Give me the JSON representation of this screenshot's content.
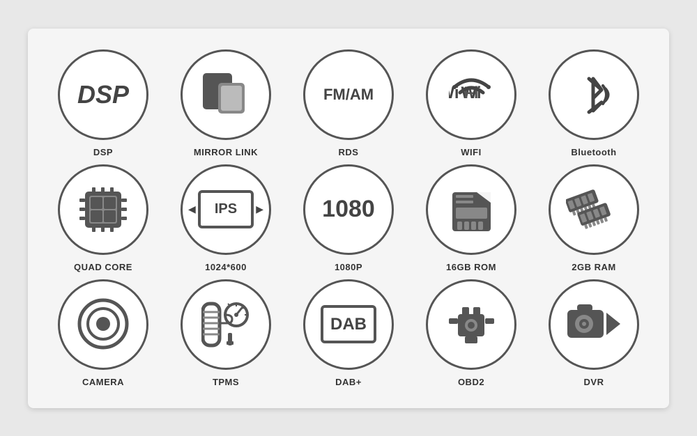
{
  "features": {
    "row1": [
      {
        "id": "dsp",
        "label": "DSP"
      },
      {
        "id": "mirror-link",
        "label": "MIRROR LINK"
      },
      {
        "id": "rds",
        "label": "RDS"
      },
      {
        "id": "wifi",
        "label": "WIFI"
      },
      {
        "id": "bluetooth",
        "label": "Bluetooth"
      }
    ],
    "row2": [
      {
        "id": "quad-core",
        "label": "QUAD CORE"
      },
      {
        "id": "ips",
        "label": "1024*600"
      },
      {
        "id": "1080p",
        "label": "1080P"
      },
      {
        "id": "16gb-rom",
        "label": "16GB ROM"
      },
      {
        "id": "2gb-ram",
        "label": "2GB RAM"
      }
    ],
    "row3": [
      {
        "id": "camera",
        "label": "CAMERA"
      },
      {
        "id": "tpms",
        "label": "TPMS"
      },
      {
        "id": "dab",
        "label": "DAB+"
      },
      {
        "id": "obd2",
        "label": "OBD2"
      },
      {
        "id": "dvr",
        "label": "DVR"
      }
    ]
  }
}
